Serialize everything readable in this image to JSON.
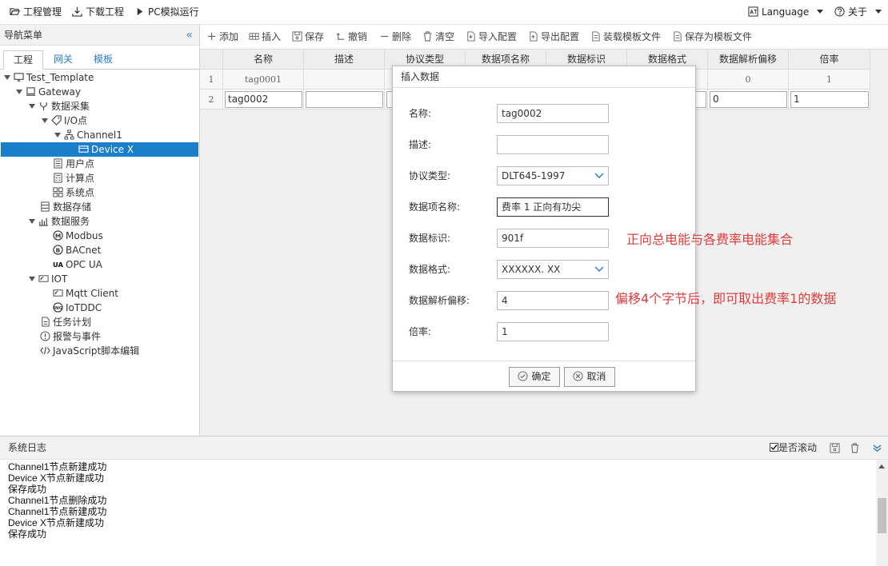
{
  "topbar": {
    "project_mgmt": "工程管理",
    "download": "下载工程",
    "pc_sim": "PC模拟运行",
    "language": "Language",
    "about": "关于"
  },
  "nav": {
    "title": "导航菜单",
    "tabs": [
      "工程",
      "网关",
      "模板"
    ],
    "tree": {
      "root": "Test_Template",
      "gateway": "Gateway",
      "data_collect": "数据采集",
      "io_points": "I/O点",
      "channel": "Channel1",
      "device": "Device X",
      "user_points": "用户点",
      "calc_points": "计算点",
      "sys_points": "系统点",
      "data_storage": "数据存储",
      "data_service": "数据服务",
      "modbus": "Modbus",
      "bacnet": "BACnet",
      "opcua": "OPC UA",
      "iot": "IOT",
      "mqtt": "Mqtt Client",
      "iotddc": "IoTDDC",
      "tasks": "任务计划",
      "alarms": "报警与事件",
      "js_editor": "JavaScript脚本编辑"
    }
  },
  "toolbar": {
    "add": "添加",
    "insert": "插入",
    "save": "保存",
    "undo": "撤销",
    "delete": "删除",
    "clear": "清空",
    "import_cfg": "导入配置",
    "export_cfg": "导出配置",
    "load_tpl": "装载模板文件",
    "save_tpl": "保存为模板文件"
  },
  "grid": {
    "headers": [
      "名称",
      "描述",
      "协议类型",
      "数据项名称",
      "数据标识",
      "数据格式",
      "数据解析偏移",
      "倍率"
    ],
    "row1": {
      "idx": "1",
      "name": "tag0001",
      "offset": "0",
      "rate": "1"
    },
    "row2": {
      "idx": "2",
      "name": "tag0002",
      "offset": "0",
      "rate": "1"
    }
  },
  "dialog": {
    "title": "插入数据",
    "name_label": "名称:",
    "name_value": "tag0002",
    "desc_label": "描述:",
    "desc_value": "",
    "protocol_label": "协议类型:",
    "protocol_value": "DLT645-1997",
    "item_label": "数据项名称:",
    "item_value": "费率 1 正向有功尖",
    "id_label": "数据标识:",
    "id_value": "901f",
    "format_label": "数据格式:",
    "format_value": "XXXXXX. XX",
    "offset_label": "数据解析偏移:",
    "offset_value": "4",
    "rate_label": "倍率:",
    "rate_value": "1",
    "ok": "确定",
    "cancel": "取消"
  },
  "annotations": {
    "id_note": "正向总电能与各费率电能集合",
    "offset_note": "偏移4个字节后，即可取出费率1的数据"
  },
  "log": {
    "title": "系统日志",
    "autoscroll": "是否滚动",
    "lines": [
      "Channel1节点新建成功",
      "Device X节点新建成功",
      "保存成功",
      "Channel1节点删除成功",
      "Channel1节点新建成功",
      "Device X节点新建成功",
      "保存成功"
    ]
  },
  "colors": {
    "accent": "#1a7ecb",
    "annotation": "#e23b3b"
  }
}
